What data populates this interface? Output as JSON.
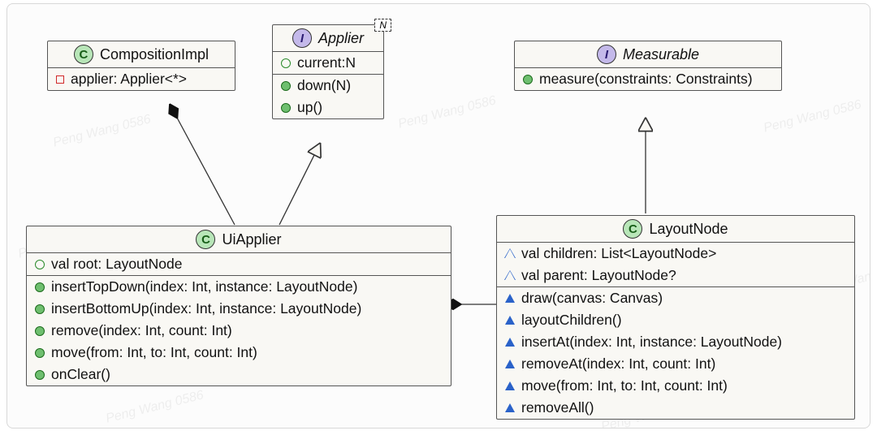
{
  "watermark": "Peng Wang 0586",
  "classes": {
    "compositionImpl": {
      "stereotype": "C",
      "name": "CompositionImpl",
      "attrs": [
        {
          "vis": "sqr",
          "text": "applier: Applier<*>"
        }
      ]
    },
    "applier": {
      "stereotype": "I",
      "name": "Applier",
      "template": "N",
      "attrs": [
        {
          "vis": "opn-g",
          "text": "current:N"
        }
      ],
      "ops": [
        {
          "vis": "pub-g",
          "text": "down(N)"
        },
        {
          "vis": "pub-g",
          "text": "up()"
        }
      ]
    },
    "measurable": {
      "stereotype": "I",
      "name": "Measurable",
      "ops": [
        {
          "vis": "pub-g",
          "text": "measure(constraints: Constraints)"
        }
      ]
    },
    "uiApplier": {
      "stereotype": "C",
      "name": "UiApplier",
      "attrs": [
        {
          "vis": "opn-g",
          "text": "val root: LayoutNode"
        }
      ],
      "ops": [
        {
          "vis": "pub-g",
          "text": "insertTopDown(index: Int, instance: LayoutNode)"
        },
        {
          "vis": "pub-g",
          "text": "insertBottomUp(index: Int, instance: LayoutNode)"
        },
        {
          "vis": "pub-g",
          "text": "remove(index: Int, count: Int)"
        },
        {
          "vis": "pub-g",
          "text": "move(from: Int, to: Int, count: Int)"
        },
        {
          "vis": "pub-g",
          "text": "onClear()"
        }
      ]
    },
    "layoutNode": {
      "stereotype": "C",
      "name": "LayoutNode",
      "attrs": [
        {
          "vis": "tri-open",
          "text": "val children: List<LayoutNode>"
        },
        {
          "vis": "tri-open",
          "text": "val parent: LayoutNode?"
        }
      ],
      "ops": [
        {
          "vis": "tri",
          "text": "draw(canvas: Canvas)"
        },
        {
          "vis": "tri",
          "text": "layoutChildren()"
        },
        {
          "vis": "tri",
          "text": "insertAt(index: Int, instance: LayoutNode)"
        },
        {
          "vis": "tri",
          "text": "removeAt(index: Int, count: Int)"
        },
        {
          "vis": "tri",
          "text": "move(from: Int, to: Int, count: Int)"
        },
        {
          "vis": "tri",
          "text": "removeAll()"
        }
      ]
    }
  }
}
